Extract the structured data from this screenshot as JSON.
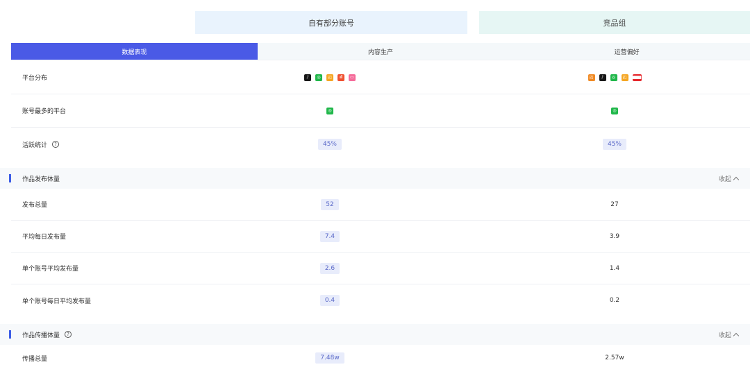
{
  "columns": {
    "own": "自有部分账号",
    "competitor": "竞品组"
  },
  "tabs": [
    {
      "label": "数据表现",
      "active": true
    },
    {
      "label": "内容生产",
      "active": false
    },
    {
      "label": "运营偏好",
      "active": false
    }
  ],
  "overview": {
    "platform_distribution": {
      "label": "平台分布",
      "own_icons": [
        "tiktok-icon",
        "wechat-channels-icon",
        "orange-app-icon",
        "red-app-icon",
        "pink-app-icon"
      ],
      "competitor_icons": [
        "orange-app-icon",
        "tiktok-icon",
        "wechat-channels-icon",
        "orange-app-icon",
        "red-wide-app-icon"
      ]
    },
    "top_platform": {
      "label": "账号最多的平台",
      "own_icon": "wechat-channels-icon",
      "competitor_icon": "wechat-channels-icon"
    },
    "activity": {
      "label": "活跃统计",
      "own": "45%",
      "competitor": "45%"
    }
  },
  "publish_section": {
    "title": "作品发布体量",
    "toggle": "收起",
    "rows": [
      {
        "label": "发布总量",
        "own": "52",
        "competitor": "27"
      },
      {
        "label": "平均每日发布量",
        "own": "7.4",
        "competitor": "3.9"
      },
      {
        "label": "单个账号平均发布量",
        "own": "2.6",
        "competitor": "1.4"
      },
      {
        "label": "单个账号每日平均发布量",
        "own": "0.4",
        "competitor": "0.2"
      }
    ]
  },
  "spread_section": {
    "title": "作品传播体量",
    "toggle": "收起",
    "rows": [
      {
        "label": "传播总量",
        "own": "7.48w",
        "competitor": "2.57w"
      }
    ]
  },
  "icons": {
    "help": "?",
    "tiktok": "♪",
    "wechat": "◎",
    "orange": "◰",
    "red": "ıl",
    "pink": "▭",
    "red_wide": "████"
  }
}
